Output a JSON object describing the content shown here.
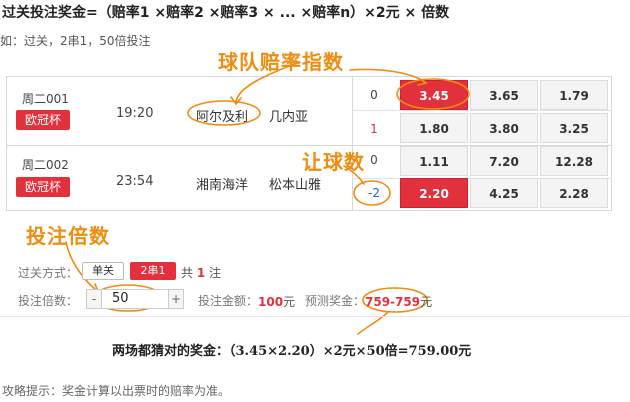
{
  "header": {
    "formula": "过关投注奖金=（赔率1 ×赔率2 ×赔率3 × ... ×赔率n）×2元 × 倍数",
    "example": "如：过关，2串1，50倍投注"
  },
  "matches": [
    {
      "code": "周二001",
      "league": "欧冠杯",
      "time": "19:20",
      "home": "阿尔及利",
      "away": "几内亚",
      "handicap_top": "0",
      "handicap_bottom": "1",
      "odds_top": [
        "3.45",
        "3.65",
        "1.79"
      ],
      "odds_bottom": [
        "1.80",
        "3.80",
        "3.25"
      ]
    },
    {
      "code": "周二002",
      "league": "欧冠杯",
      "time": "23:54",
      "home": "湘南海洋",
      "away": "松本山雅",
      "handicap_top": "0",
      "handicap_bottom": "-2",
      "odds_top": [
        "1.11",
        "7.20",
        "12.28"
      ],
      "odds_bottom": [
        "2.20",
        "4.25",
        "2.28"
      ]
    }
  ],
  "annotations": {
    "team_odds": "球队赔率指数",
    "handicap": "让球数",
    "multiplier": "投注倍数"
  },
  "bet_panel": {
    "pass_label": "过关方式：",
    "single": "单关",
    "combo": "2串1",
    "total_prefix": "共",
    "total_count": "1",
    "total_suffix": "注",
    "multiplier_label": "投注倍数：",
    "minus": "-",
    "plus": "+",
    "multiplier_value": "50",
    "amount_label": "投注金额：",
    "amount": "100",
    "amount_unit": "元",
    "prize_label": "预测奖金：",
    "prize": "759-759",
    "prize_unit": "元"
  },
  "result": "两场都猜对的奖金：（3.45×2.20）×2元×50倍=759.00元",
  "tip": "攻略提示：奖金计算以出票时的赔率为准。",
  "colors": {
    "accent": "#e2313c",
    "annotation": "#f08c10",
    "blue": "#2a66b8"
  }
}
